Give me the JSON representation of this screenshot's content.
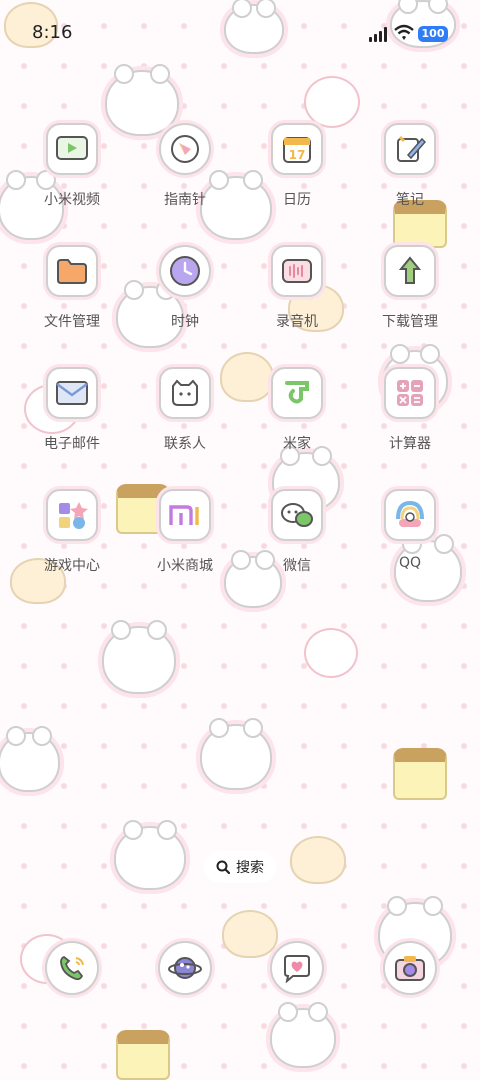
{
  "status_bar": {
    "time": "8:16",
    "battery": "100",
    "icons": [
      "signal-icon",
      "wifi-icon",
      "battery-icon"
    ]
  },
  "apps": [
    {
      "label": "小米视频",
      "icon": "video-icon",
      "color": "#7cc66a"
    },
    {
      "label": "指南针",
      "icon": "compass-icon",
      "color": "#f3a6b8"
    },
    {
      "label": "日历",
      "icon": "calendar-icon",
      "color": "#f2b84b"
    },
    {
      "label": "笔记",
      "icon": "notes-icon",
      "color": "#8fb3f0"
    },
    {
      "label": "文件管理",
      "icon": "folder-icon",
      "color": "#f6a86a"
    },
    {
      "label": "时钟",
      "icon": "clock-icon",
      "color": "#b9a6ef"
    },
    {
      "label": "录音机",
      "icon": "recorder-icon",
      "color": "#f2a3b4"
    },
    {
      "label": "下载管理",
      "icon": "download-icon",
      "color": "#9fce7c"
    },
    {
      "label": "电子邮件",
      "icon": "mail-icon",
      "color": "#7c9bd6"
    },
    {
      "label": "联系人",
      "icon": "contacts-icon",
      "color": "#e7bd6a"
    },
    {
      "label": "米家",
      "icon": "mijia-icon",
      "color": "#7cc66a"
    },
    {
      "label": "计算器",
      "icon": "calculator-icon",
      "color": "#e4a3b9"
    },
    {
      "label": "游戏中心",
      "icon": "game-center-icon",
      "color": "#a58be8"
    },
    {
      "label": "小米商城",
      "icon": "mi-store-icon",
      "color": "#c47be0"
    },
    {
      "label": "微信",
      "icon": "wechat-icon",
      "color": "#7cc66a"
    },
    {
      "label": "QQ",
      "icon": "qq-icon",
      "color": "#7ab6e8"
    }
  ],
  "search": {
    "label": "搜索",
    "icon": "search-icon"
  },
  "dock": [
    {
      "icon": "phone-icon",
      "color": "#7cc66a"
    },
    {
      "icon": "browser-icon",
      "color": "#8b86d6"
    },
    {
      "icon": "messages-icon",
      "color": "#f08aa8"
    },
    {
      "icon": "camera-icon",
      "color": "#a58be8"
    }
  ]
}
